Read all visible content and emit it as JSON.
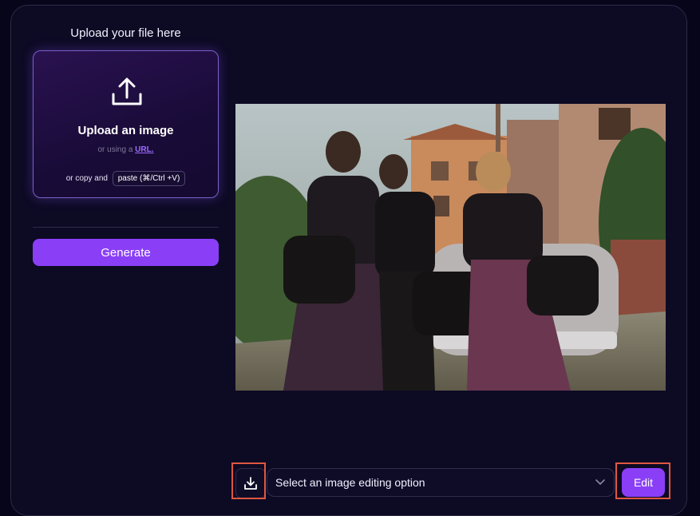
{
  "upload": {
    "title": "Upload your file here",
    "heading": "Upload an image",
    "or_using": "or using a ",
    "url_link": "URL.",
    "or_copy": "or copy and",
    "paste_label": "paste (⌘/Ctrl +V)",
    "icon": "upload-icon"
  },
  "generate": {
    "label": "Generate"
  },
  "preview": {
    "description_icon": "photo"
  },
  "toolbar": {
    "download_icon": "download-icon",
    "select_value": "Select an image editing option",
    "select_icon": "chevron-down-icon",
    "edit_label": "Edit"
  },
  "colors": {
    "background": "#07051a",
    "panel": "#0d0a24",
    "accent": "#8a3ff7",
    "highlight": "#e0573f",
    "link": "#9d6bff"
  }
}
